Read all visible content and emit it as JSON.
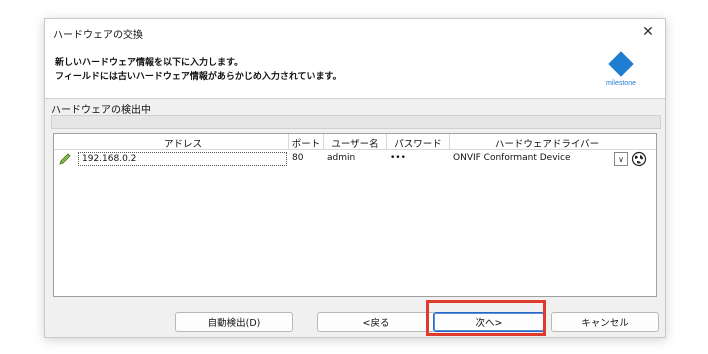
{
  "window": {
    "title": "ハードウェアの交換",
    "close_label": "✕"
  },
  "header": {
    "line1": "新しいハードウェア情報を以下に入力します。",
    "line2": "フィールドには古いハードウェア情報があらかじめ入力されています。",
    "logo_text": "milestone",
    "logo_color": "#1e7fd1"
  },
  "detection": {
    "label": "ハードウェアの検出中",
    "progress_fraction": 0
  },
  "grid": {
    "columns": [
      "アドレス",
      "ポート",
      "ユーザー名",
      "パスワード",
      "ハードウェアドライバー"
    ],
    "rows": [
      {
        "address": "192.168.0.2",
        "port": "80",
        "username": "admin",
        "password": "•••",
        "driver": "ONVIF Conformant Device"
      }
    ],
    "row_icon": "pencil-icon",
    "row_action_icon": "globe-icon"
  },
  "buttons": {
    "auto_detect": "自動検出(D)",
    "back": "<戻る",
    "next": "次へ>",
    "cancel": "キャンセル"
  },
  "accent_colors": {
    "highlight": "#e03a2c",
    "focus": "#2a66c8"
  }
}
